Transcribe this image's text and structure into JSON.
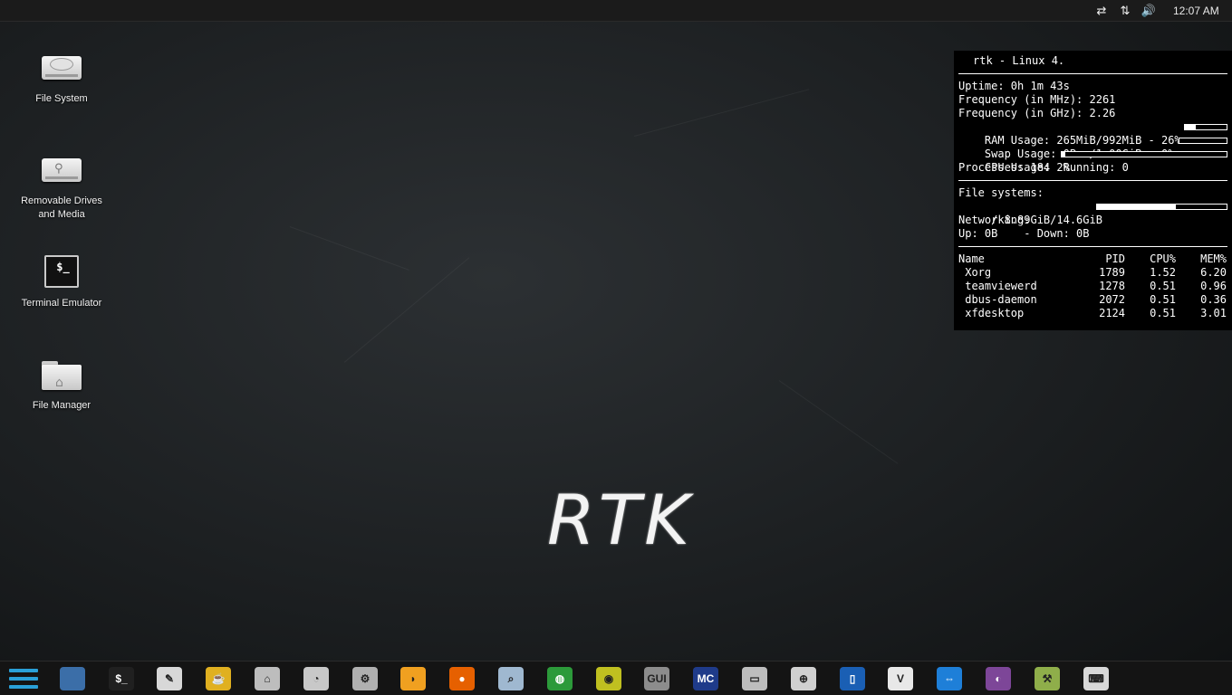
{
  "top_panel": {
    "tray": [
      {
        "name": "network-wired-icon",
        "glyph": "⇄"
      },
      {
        "name": "network-transfer-icon",
        "glyph": "⇅"
      },
      {
        "name": "volume-icon",
        "glyph": "🔊"
      }
    ],
    "clock": "12:07 AM"
  },
  "desktop_icons": [
    {
      "name": "file-system",
      "label": "File System"
    },
    {
      "name": "removable-drives",
      "label": "Removable Drives and Media"
    },
    {
      "name": "terminal-emulator",
      "label": "Terminal Emulator",
      "glyph": "$_"
    },
    {
      "name": "file-manager",
      "label": "File Manager"
    }
  ],
  "conky": {
    "title": "rtk - Linux 4.",
    "uptime": "Uptime: 0h 1m 43s",
    "freq_mhz": "Frequency (in MHz): 2261",
    "freq_ghz": "Frequency (in GHz): 2.26",
    "ram": "RAM Usage: 265MiB/992MiB - 26%",
    "ram_pct": 26,
    "swap": "Swap Usage: 0B  /1.00GiB - 0%",
    "swap_pct": 0,
    "cpu": "CPU Usage: 2%",
    "cpu_pct": 2,
    "processes": "Processes: 184  Running: 0",
    "fs_title": "File systems:",
    "fs_root": " / 8.89GiB/14.6GiB",
    "fs_pct": 61,
    "net_title": "Networking:",
    "net": "Up: 0B    - Down: 0B",
    "proc_header": {
      "name": "Name",
      "pid": "PID",
      "cpu": "CPU%",
      "mem": "MEM%"
    },
    "procs": [
      {
        "name": " Xorg",
        "pid": "1789",
        "cpu": "1.52",
        "mem": "6.20"
      },
      {
        "name": " teamviewerd",
        "pid": "1278",
        "cpu": "0.51",
        "mem": "0.96"
      },
      {
        "name": " dbus-daemon",
        "pid": "2072",
        "cpu": "0.51",
        "mem": "0.36"
      },
      {
        "name": " xfdesktop",
        "pid": "2124",
        "cpu": "0.51",
        "mem": "3.01"
      }
    ]
  },
  "logo": "RTK",
  "dock": {
    "items": [
      {
        "name": "menu-icon"
      },
      {
        "name": "show-desktop-icon",
        "color": "#3b6ea8",
        "glyph": ""
      },
      {
        "name": "terminal-icon",
        "color": "#202020",
        "glyph": "$_"
      },
      {
        "name": "text-editor-icon",
        "color": "#d8d8d8",
        "glyph": "✎"
      },
      {
        "name": "teapot-icon",
        "color": "#e0b020",
        "glyph": "☕"
      },
      {
        "name": "file-manager-icon",
        "color": "#bdbdbd",
        "glyph": "⌂"
      },
      {
        "name": "disk-usage-icon",
        "color": "#c8c8c8",
        "glyph": "◔"
      },
      {
        "name": "settings-tools-icon",
        "color": "#b0b0b0",
        "glyph": "⚙"
      },
      {
        "name": "vpn-shield-icon",
        "color": "#f0a020",
        "glyph": "◗"
      },
      {
        "name": "firefox-icon",
        "color": "#e66000",
        "glyph": "●"
      },
      {
        "name": "search-magnifier-icon",
        "color": "#9fb8d0",
        "glyph": "⌕"
      },
      {
        "name": "disk-utility-icon",
        "color": "#2c9a3a",
        "glyph": "◍"
      },
      {
        "name": "eye-target-icon",
        "color": "#c0c020",
        "glyph": "◉"
      },
      {
        "name": "gui-tool-icon",
        "color": "#8c8c8c",
        "glyph": "GUI"
      },
      {
        "name": "midnight-commander-icon",
        "color": "#1f3b8a",
        "glyph": "MC"
      },
      {
        "name": "hard-drive-icon",
        "color": "#bdbdbd",
        "glyph": "▭"
      },
      {
        "name": "crosshair-icon",
        "color": "#d0d0d0",
        "glyph": "⊕"
      },
      {
        "name": "phone-tool-icon",
        "color": "#1a5fb4",
        "glyph": "▯"
      },
      {
        "name": "vnc-viewer-icon",
        "color": "#e8e8e8",
        "glyph": "V"
      },
      {
        "name": "teamviewer-icon",
        "color": "#1e7fd8",
        "glyph": "⇔"
      },
      {
        "name": "tor-onion-icon",
        "color": "#7d4698",
        "glyph": "◐"
      },
      {
        "name": "network-tool-icon",
        "color": "#8fae4a",
        "glyph": "⚒"
      },
      {
        "name": "keyboard-icon",
        "color": "#d8d8d8",
        "glyph": "⌨"
      }
    ]
  }
}
